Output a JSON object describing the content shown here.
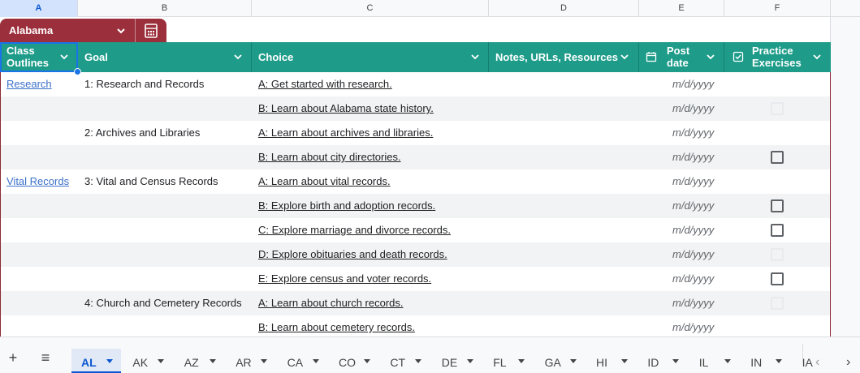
{
  "column_letters": [
    "A",
    "B",
    "C",
    "D",
    "E",
    "F"
  ],
  "table_name": "Alabama",
  "headers": {
    "class_outlines": [
      "Class",
      "Outlines"
    ],
    "goal": "Goal",
    "choice": "Choice",
    "notes": "Notes, URLs, Resources",
    "post_date": [
      "Post",
      "date"
    ],
    "practice": [
      "Practice",
      "Exercises"
    ]
  },
  "rows": [
    {
      "outline": "Research",
      "goal": "1: Research and Records",
      "choice": "A: Get started with research.",
      "date": "m/d/yyyy",
      "checkbox": "none"
    },
    {
      "outline": "",
      "goal": "",
      "choice": "B: Learn about Alabama state history.",
      "date": "m/d/yyyy",
      "checkbox": "faint"
    },
    {
      "outline": "",
      "goal": "2: Archives and Libraries",
      "choice": "A: Learn about archives and libraries.",
      "date": "m/d/yyyy",
      "checkbox": "none"
    },
    {
      "outline": "",
      "goal": "",
      "choice": "B: Learn about city directories.",
      "date": "m/d/yyyy",
      "checkbox": "visible"
    },
    {
      "outline": "Vital Records",
      "goal": "3: Vital and Census Records",
      "choice": "A: Learn about vital records.",
      "date": "m/d/yyyy",
      "checkbox": "none"
    },
    {
      "outline": "",
      "goal": "",
      "choice": "B: Explore birth and adoption records.",
      "date": "m/d/yyyy",
      "checkbox": "visible"
    },
    {
      "outline": "",
      "goal": "",
      "choice": "C: Explore marriage and divorce records.",
      "date": "m/d/yyyy",
      "checkbox": "visible"
    },
    {
      "outline": "",
      "goal": "",
      "choice": "D: Explore obituaries and death records.",
      "date": "m/d/yyyy",
      "checkbox": "faint"
    },
    {
      "outline": "",
      "goal": "",
      "choice": "E: Explore census and voter records.",
      "date": "m/d/yyyy",
      "checkbox": "visible"
    },
    {
      "outline": "",
      "goal": "4: Church and Cemetery Records",
      "choice": "A: Learn about church records.",
      "date": "m/d/yyyy",
      "checkbox": "faint"
    },
    {
      "outline": "",
      "goal": "",
      "choice": "B: Learn about cemetery records.",
      "date": "m/d/yyyy",
      "checkbox": "none"
    }
  ],
  "sheet_tabs": [
    "AL",
    "AK",
    "AZ",
    "AR",
    "CA",
    "CO",
    "CT",
    "DE",
    "FL",
    "GA",
    "HI",
    "ID",
    "IL",
    "IN",
    "IA"
  ],
  "active_tab": "AL",
  "colors": {
    "table_header": "#1e9c89",
    "table_chip": "#9c2f3c",
    "link": "#3c6fc9",
    "active_tab": "#0b57d0"
  }
}
